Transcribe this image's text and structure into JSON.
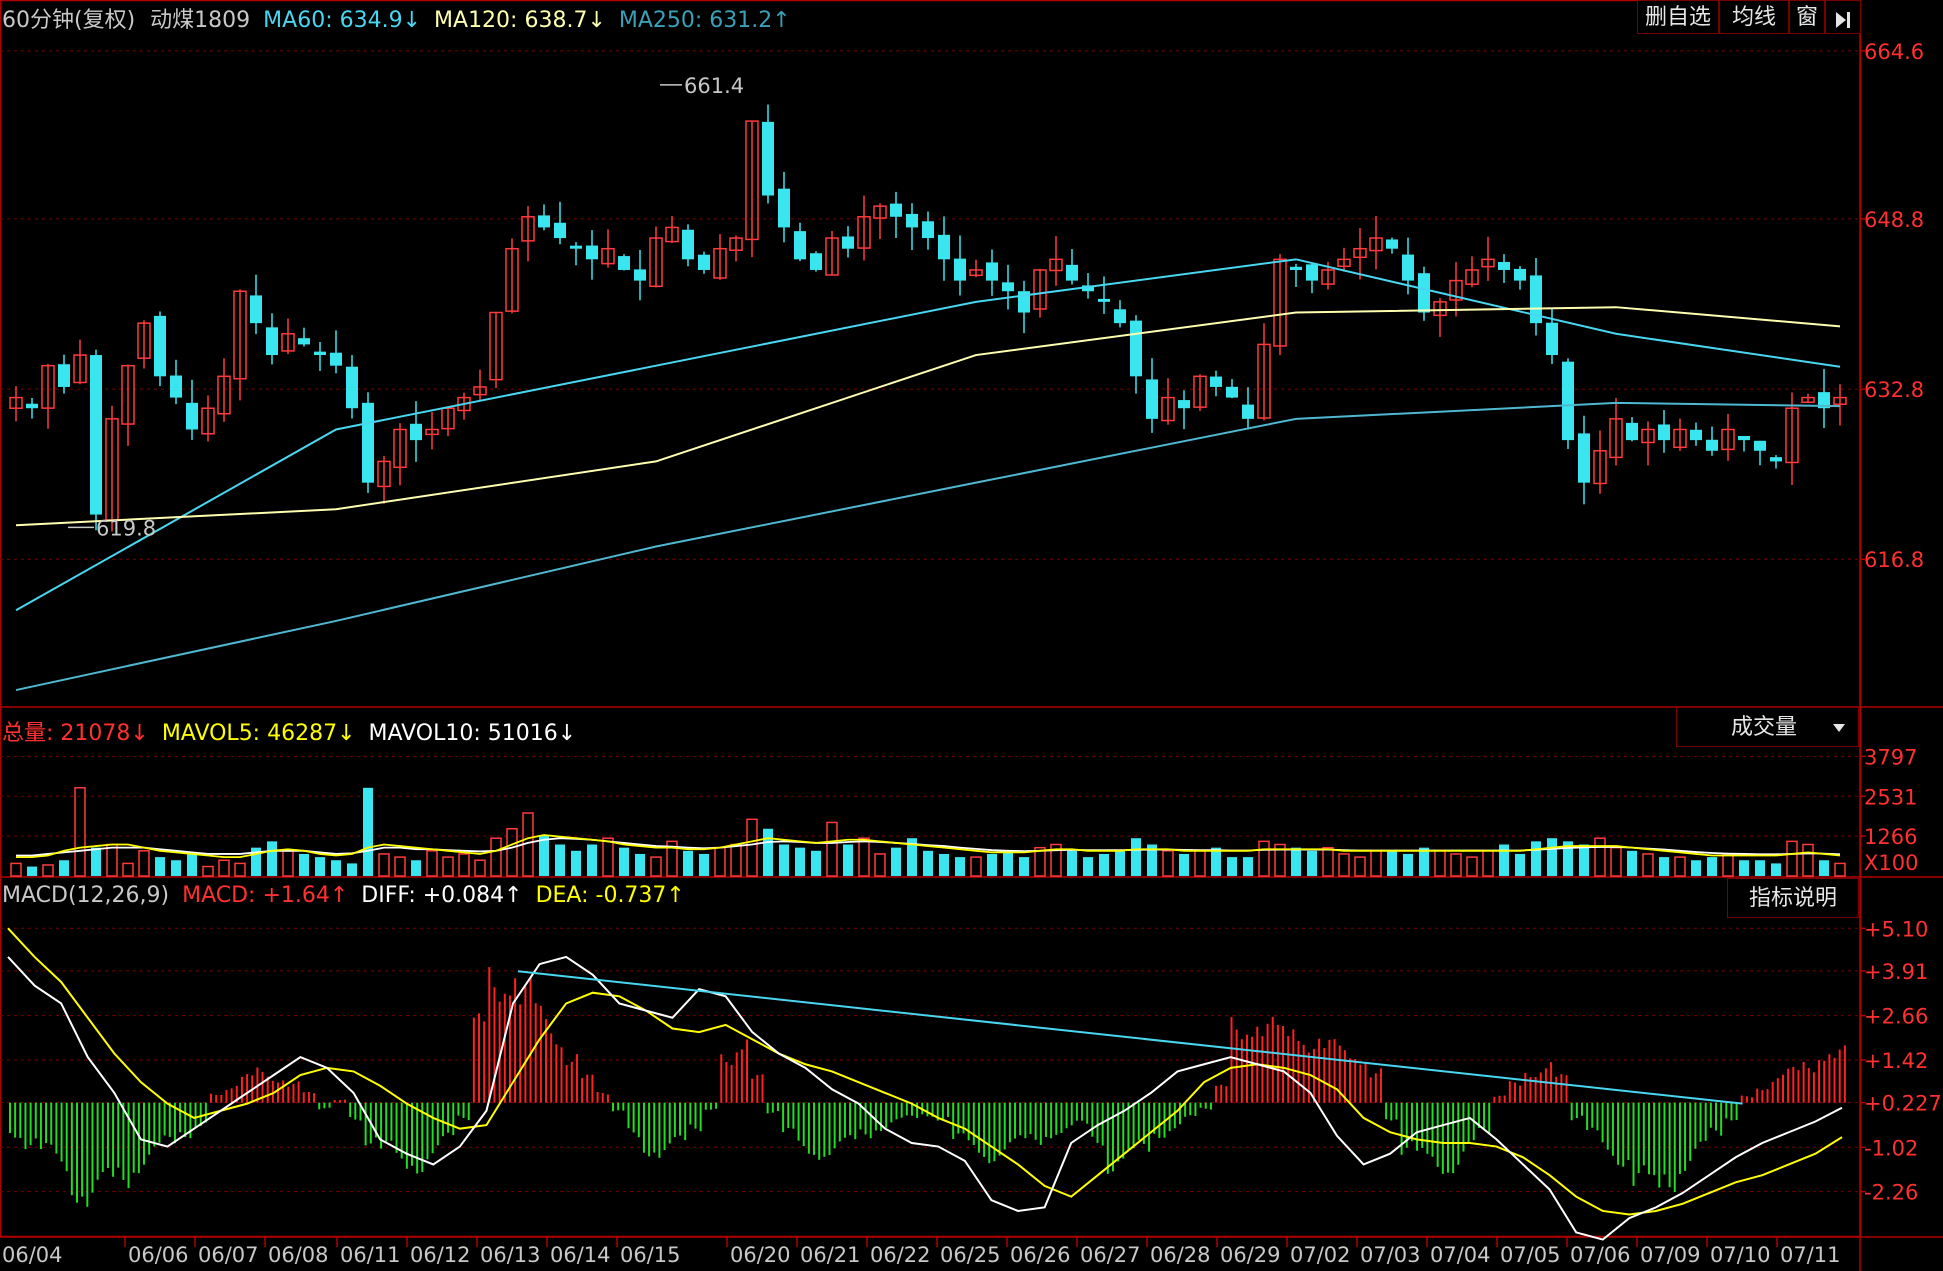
{
  "colors": {
    "up": "#ff3b3b",
    "down": "#39e6f0",
    "ma60": "#49d6f0",
    "ma120": "#ffffb0",
    "ma250": "#4fb8d0",
    "frame": "#b00000",
    "vol_ma5": "#ffff00",
    "vol_ma10": "#ffffff",
    "macd_up": "#ff2020",
    "macd_down": "#22dd22",
    "diff": "#ffffff",
    "dea": "#ffff00",
    "trendline": "#49d6f0",
    "axis_text": "#ff3030"
  },
  "header": {
    "period": "60分钟(复权)",
    "symbol": "动煤1809",
    "ma60": "MA60: 634.9↓",
    "ma120": "MA120: 638.7↓",
    "ma250": "MA250: 631.2↑"
  },
  "toolbar": {
    "delete_label": "删自选",
    "avg_label": "均线",
    "window_label": "窗",
    "switch_icon": "play-bar-icon"
  },
  "volume_header": {
    "total": "总量: 21078↓",
    "mavol5": "MAVOL5: 46287↓",
    "mavol10": "MAVOL10: 51016↓",
    "selector": "成交量",
    "selector_icon": "dropdown-triangle-icon"
  },
  "macd_header": {
    "name": "MACD(12,26,9)",
    "macd": "MACD: +1.64↑",
    "diff": "DIFF: +0.084↑",
    "dea": "DEA: -0.737↑",
    "help": "指标说明"
  },
  "chart_data": [
    {
      "type": "candlestick",
      "panel": "price",
      "y_ticks": [
        "664.6",
        "648.8",
        "632.8",
        "616.8"
      ],
      "y_tick_values": [
        664.6,
        648.8,
        632.8,
        616.8
      ],
      "ylim": [
        603,
        666
      ],
      "high_label": "661.4",
      "low_label": "619.8",
      "close_path": [
        632,
        631,
        635,
        633,
        636,
        621,
        630,
        635,
        639,
        634,
        632,
        629,
        631,
        634,
        642,
        639,
        636,
        638,
        637,
        636,
        635,
        631,
        624,
        626,
        629,
        628,
        629,
        631,
        632,
        633,
        640,
        646,
        649,
        648,
        647,
        646,
        645,
        646,
        644,
        643,
        647,
        648,
        645,
        644,
        646,
        647,
        658,
        651,
        648,
        645,
        644,
        647,
        646,
        649,
        650,
        649,
        648,
        647,
        645,
        643,
        644,
        643,
        642,
        640,
        644,
        645,
        643,
        642,
        641,
        639,
        634,
        630,
        632,
        631,
        634,
        633,
        632,
        630,
        637,
        645,
        644,
        643,
        644,
        645,
        646,
        647,
        646,
        643,
        640,
        641,
        643,
        644,
        645,
        644,
        643,
        639,
        636,
        628,
        624,
        627,
        630,
        628,
        629,
        628,
        629,
        628,
        627,
        629,
        628,
        627,
        626,
        631,
        632,
        631,
        632
      ]
    },
    {
      "type": "line",
      "name": "MA60",
      "panel": "price",
      "x": [
        0,
        20,
        40,
        60,
        80,
        100,
        114
      ],
      "y": [
        612,
        629,
        635,
        641,
        645,
        638,
        634.9
      ]
    },
    {
      "type": "line",
      "name": "MA120",
      "panel": "price",
      "x": [
        0,
        20,
        40,
        60,
        80,
        100,
        114
      ],
      "y": [
        620,
        621.5,
        626,
        636,
        640,
        640.5,
        638.7
      ]
    },
    {
      "type": "line",
      "name": "MA250",
      "panel": "price",
      "x": [
        0,
        20,
        40,
        60,
        80,
        100,
        114
      ],
      "y": [
        604.5,
        611,
        618,
        624,
        630,
        631.5,
        631.2
      ]
    },
    {
      "type": "bar",
      "panel": "volume",
      "y_ticks": [
        "3797",
        "2531",
        "1266",
        "X100"
      ],
      "y_tick_values": [
        3797,
        2531,
        1266
      ],
      "ylim": [
        0,
        4000
      ],
      "values": [
        400,
        300,
        350,
        500,
        2800,
        900,
        1000,
        400,
        800,
        600,
        500,
        700,
        300,
        500,
        400,
        900,
        1100,
        800,
        700,
        600,
        500,
        400,
        2800,
        700,
        600,
        500,
        800,
        600,
        700,
        500,
        1200,
        1500,
        2000,
        1300,
        1000,
        800,
        1000,
        1200,
        900,
        700,
        600,
        1100,
        800,
        700,
        900,
        1000,
        1800,
        1500,
        1000,
        900,
        800,
        1700,
        1000,
        1200,
        700,
        900,
        1200,
        800,
        700,
        600,
        600,
        700,
        800,
        600,
        900,
        1000,
        800,
        600,
        700,
        800,
        1200,
        1000,
        800,
        700,
        800,
        900,
        600,
        600,
        1100,
        1000,
        900,
        800,
        900,
        700,
        600,
        800,
        800,
        700,
        900,
        800,
        700,
        600,
        800,
        1000,
        700,
        1100,
        1200,
        1100,
        1000,
        1200,
        900,
        800,
        700,
        600,
        600,
        500,
        600,
        700,
        500,
        500,
        400,
        1100,
        1000,
        500,
        400
      ],
      "ma5": [
        600,
        600,
        650,
        800,
        900,
        950,
        1000,
        1000,
        900,
        800,
        750,
        700,
        650,
        600,
        600,
        700,
        800,
        850,
        800,
        700,
        650,
        700,
        900,
        1000,
        950,
        900,
        850,
        800,
        750,
        700,
        800,
        1000,
        1200,
        1300,
        1250,
        1200,
        1150,
        1100,
        1000,
        950,
        900,
        900,
        850,
        850,
        900,
        1000,
        1100,
        1200,
        1150,
        1100,
        1050,
        1100,
        1150,
        1150,
        1100,
        1050,
        1000,
        950,
        900,
        850,
        800,
        750,
        750,
        750,
        800,
        850,
        850,
        800,
        800,
        800,
        850,
        850,
        850,
        800,
        800,
        800,
        800,
        800,
        850,
        850,
        850,
        850,
        850,
        800,
        800,
        800,
        800,
        800,
        800,
        800,
        800,
        800,
        800,
        800,
        800,
        850,
        900,
        950,
        950,
        950,
        950,
        900,
        850,
        800,
        750,
        700,
        650,
        650,
        650,
        650,
        650,
        700,
        750,
        700,
        650
      ],
      "ma10": [
        650,
        650,
        700,
        750,
        800,
        850,
        900,
        900,
        900,
        850,
        800,
        750,
        700,
        700,
        700,
        750,
        800,
        800,
        800,
        750,
        700,
        720,
        800,
        900,
        900,
        850,
        850,
        820,
        800,
        780,
        800,
        900,
        1050,
        1150,
        1200,
        1180,
        1150,
        1100,
        1050,
        1000,
        950,
        930,
        900,
        880,
        900,
        950,
        1000,
        1080,
        1100,
        1080,
        1050,
        1050,
        1080,
        1100,
        1080,
        1050,
        1020,
        980,
        950,
        900,
        860,
        820,
        800,
        790,
        800,
        820,
        830,
        820,
        820,
        820,
        830,
        840,
        840,
        830,
        820,
        820,
        810,
        810,
        830,
        840,
        840,
        840,
        840,
        820,
        810,
        810,
        810,
        810,
        810,
        810,
        810,
        810,
        810,
        810,
        810,
        830,
        860,
        890,
        910,
        920,
        920,
        900,
        870,
        840,
        800,
        760,
        730,
        710,
        700,
        690,
        690,
        700,
        720,
        710,
        690
      ]
    },
    {
      "type": "bar",
      "panel": "macd",
      "y_ticks": [
        "+5.10",
        "+3.91",
        "+2.66",
        "+1.42",
        "+0.227",
        "-1.02",
        "-2.26"
      ],
      "y_tick_values": [
        5.1,
        3.91,
        2.66,
        1.42,
        0.227,
        -1.02,
        -2.26
      ],
      "ylim": [
        -3.5,
        5.5
      ],
      "macd": [
        -1,
        -1.3,
        -1.6,
        -2,
        -2.8,
        -3,
        -2.6,
        -2.4,
        -2,
        -1.6,
        -1.3,
        -1,
        -0.7,
        0.3,
        0.5,
        0.8,
        1,
        0.8,
        0.6,
        0.3,
        -0.2,
        0.1,
        -0.5,
        -1.2,
        -1.5,
        -2,
        -2,
        -1.6,
        -1.2,
        -0.5,
        2.5,
        4,
        4.2,
        3.5,
        2.8,
        2.2,
        1.5,
        0.8,
        0.3,
        -0.3,
        -1,
        -1.5,
        -1.6,
        -1.3,
        -0.8,
        -0.2,
        1.5,
        2,
        0.8,
        -0.3,
        -1,
        -1.5,
        -1.6,
        -1.5,
        -1.3,
        -1,
        -0.8,
        -0.6,
        -0.5,
        -0.4,
        -0.5,
        -1.2,
        -1.5,
        -1.7,
        -1.5,
        -1.3,
        -1.2,
        -1,
        -0.9,
        -0.7,
        -1.2,
        -2,
        -1.8,
        -1.5,
        -1,
        -0.8,
        -0.5,
        -0.2,
        0.5,
        2.5,
        2.6,
        2.4,
        2.2,
        2.3,
        2,
        1.8,
        1.6,
        1.5,
        1,
        -0.5,
        -1.5,
        -1.8,
        -2,
        -2,
        -1.5,
        -1,
        0.2,
        0.6,
        1,
        1.2,
        0.8,
        -0.5,
        -1,
        -1.5,
        -1.8,
        -2.5,
        -2.8,
        -2.5,
        -2,
        -1.5,
        -1,
        -0.5,
        0.2,
        0.5,
        0.8,
        1,
        1.2,
        1.64,
        1.6
      ],
      "diff": [
        4.3,
        3.5,
        3,
        1.5,
        0.5,
        -0.8,
        -1,
        -0.5,
        0,
        0.5,
        1,
        1.5,
        1.2,
        0.5,
        -0.8,
        -1.2,
        -1.5,
        -1,
        0,
        3,
        4.1,
        4.3,
        3.8,
        3,
        2.8,
        2.6,
        3.4,
        3.2,
        2.2,
        1.6,
        1.2,
        0.6,
        0.2,
        -0.5,
        -0.9,
        -1,
        -1.4,
        -2.5,
        -2.8,
        -2.7,
        -0.9,
        -0.4,
        0,
        0.5,
        1.1,
        1.3,
        1.5,
        1.3,
        1.1,
        0.5,
        -0.7,
        -1.5,
        -1.2,
        -0.6,
        -0.4,
        -0.2,
        -0.8,
        -1.5,
        -2.2,
        -3.4,
        -3.6,
        -3,
        -2.7,
        -2.3,
        -1.8,
        -1.3,
        -0.9,
        -0.6,
        -0.3,
        0.084
      ],
      "dea": [
        5.1,
        4.3,
        3.6,
        2.6,
        1.6,
        0.8,
        0.2,
        -0.2,
        0,
        0.2,
        0.5,
        1,
        1.2,
        1.1,
        0.7,
        0.2,
        -0.2,
        -0.5,
        -0.4,
        0.8,
        2,
        3,
        3.3,
        3.2,
        2.8,
        2.3,
        2.2,
        2.4,
        2,
        1.6,
        1.3,
        1.1,
        0.8,
        0.5,
        0.2,
        -0.2,
        -0.5,
        -1,
        -1.5,
        -2.1,
        -2.4,
        -1.8,
        -1.2,
        -0.6,
        0,
        0.8,
        1.2,
        1.3,
        1.2,
        1,
        0.6,
        -0.2,
        -0.6,
        -0.8,
        -0.9,
        -0.9,
        -1,
        -1.3,
        -1.8,
        -2.4,
        -2.8,
        -2.9,
        -2.8,
        -2.6,
        -2.3,
        -2,
        -1.8,
        -1.5,
        -1.2,
        -0.737
      ],
      "trendline": [
        [
          0,
          3.9
        ],
        [
          118,
          0.2
        ]
      ]
    }
  ],
  "x_labels": [
    "06/04",
    "06/06",
    "06/07",
    "06/08",
    "06/11",
    "06/12",
    "06/13",
    "06/14",
    "06/15",
    "06/20",
    "06/21",
    "06/22",
    "06/25",
    "06/26",
    "06/27",
    "06/28",
    "06/29",
    "07/02",
    "07/03",
    "07/04",
    "07/05",
    "07/06",
    "07/09",
    "07/10",
    "07/11"
  ]
}
